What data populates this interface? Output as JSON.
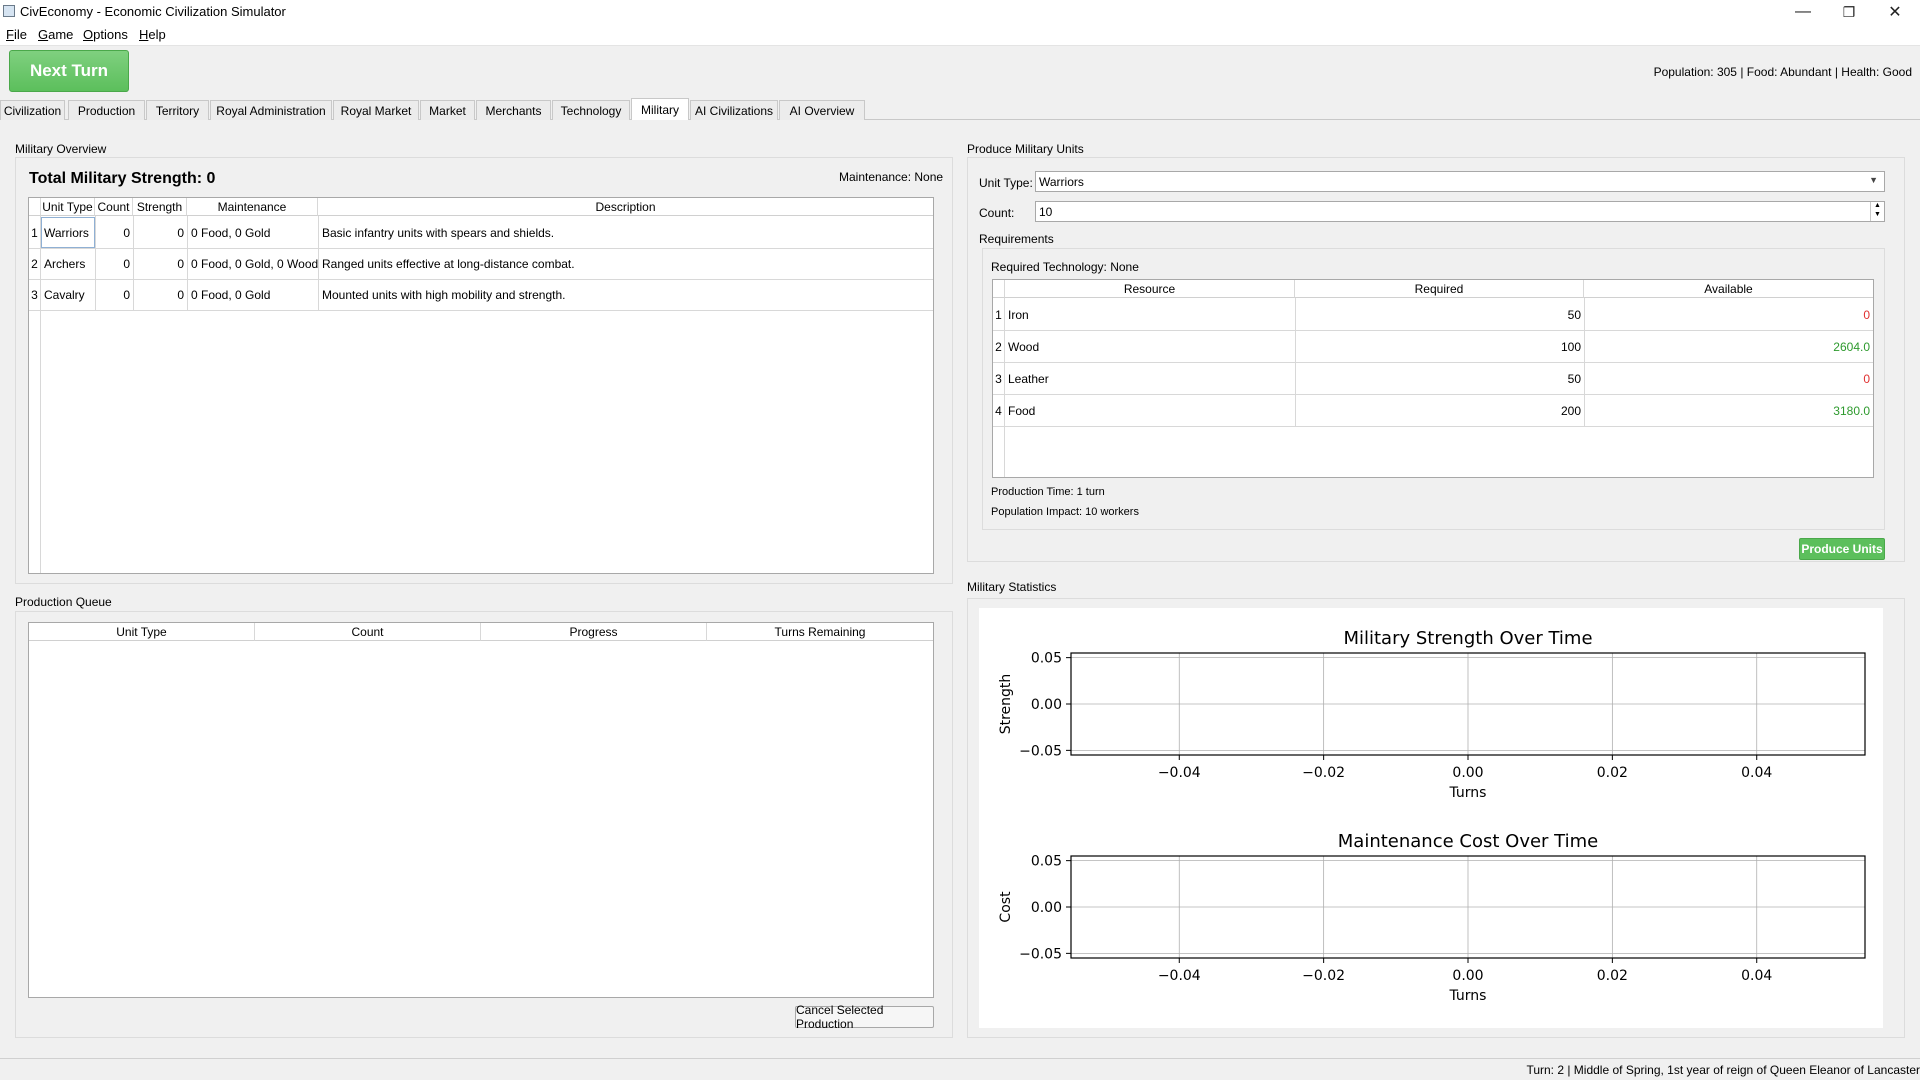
{
  "window": {
    "title": "CivEconomy - Economic Civilization Simulator",
    "minimize": "—",
    "restore": "❐",
    "close": "✕"
  },
  "menu": [
    {
      "u": "F",
      "rest": "ile"
    },
    {
      "u": "G",
      "rest": "ame"
    },
    {
      "u": "O",
      "rest": "ptions"
    },
    {
      "u": "H",
      "rest": "elp"
    }
  ],
  "toolbar": {
    "next_turn": "Next Turn",
    "status": "Population: 305 | Food: Abundant | Health: Good"
  },
  "tabs": [
    "Civilization",
    "Production",
    "Territory",
    "Royal Administration",
    "Royal Market",
    "Market",
    "Merchants",
    "Technology",
    "Military",
    "AI Civilizations",
    "AI Overview"
  ],
  "active_tab": "Military",
  "overview": {
    "group_title": "Military Overview",
    "total_label": "Total Military Strength: 0",
    "maintenance_label": "Maintenance: None",
    "headers": [
      "Unit Type",
      "Count",
      "Strength",
      "Maintenance",
      "Description"
    ],
    "rows": [
      {
        "n": "1",
        "type": "Warriors",
        "count": "0",
        "strength": "0",
        "maint": "0 Food, 0 Gold",
        "desc": "Basic infantry units with spears and shields."
      },
      {
        "n": "2",
        "type": "Archers",
        "count": "0",
        "strength": "0",
        "maint": "0 Food, 0 Gold, 0 Wood",
        "desc": "Ranged units effective at long-distance combat."
      },
      {
        "n": "3",
        "type": "Cavalry",
        "count": "0",
        "strength": "0",
        "maint": "0 Food, 0 Gold",
        "desc": "Mounted units with high mobility and strength."
      }
    ]
  },
  "queue": {
    "group_title": "Production Queue",
    "headers": [
      "Unit Type",
      "Count",
      "Progress",
      "Turns Remaining"
    ],
    "cancel": "Cancel Selected Production"
  },
  "produce": {
    "group_title": "Produce Military Units",
    "unit_type_label": "Unit Type:",
    "unit_type_value": "Warriors",
    "count_label": "Count:",
    "count_value": "10",
    "requirements_title": "Requirements",
    "required_tech": "Required Technology: None",
    "headers": [
      "Resource",
      "Required",
      "Available"
    ],
    "rows": [
      {
        "n": "1",
        "res": "Iron",
        "req": "50",
        "avail": "0",
        "ok": false
      },
      {
        "n": "2",
        "res": "Wood",
        "req": "100",
        "avail": "2604.0",
        "ok": true
      },
      {
        "n": "3",
        "res": "Leather",
        "req": "50",
        "avail": "0",
        "ok": false
      },
      {
        "n": "4",
        "res": "Food",
        "req": "200",
        "avail": "3180.0",
        "ok": true
      }
    ],
    "production_time": "Production Time: 1 turn",
    "population_impact": "Population Impact: 10 workers",
    "produce_button": "Produce Units",
    "colors": {
      "ok": "#2e9a2e",
      "bad": "#e03030"
    }
  },
  "stats": {
    "group_title": "Military Statistics",
    "charts": [
      {
        "title": "Military Strength Over Time",
        "xlabel": "Turns",
        "ylabel": "Strength",
        "xticks": [
          "−0.04",
          "−0.02",
          "0.00",
          "0.02",
          "0.04"
        ],
        "yticks": [
          "0.05",
          "0.00",
          "−0.05"
        ],
        "xlim": [
          -0.055,
          0.055
        ],
        "ylim": [
          -0.055,
          0.055
        ],
        "grid": true,
        "series": []
      },
      {
        "title": "Maintenance Cost Over Time",
        "xlabel": "Turns",
        "ylabel": "Cost",
        "xticks": [
          "−0.04",
          "−0.02",
          "0.00",
          "0.02",
          "0.04"
        ],
        "yticks": [
          "0.05",
          "0.00",
          "−0.05"
        ],
        "xlim": [
          -0.055,
          0.055
        ],
        "ylim": [
          -0.055,
          0.055
        ],
        "grid": true,
        "series": []
      }
    ]
  },
  "chart_data": [
    {
      "type": "line",
      "title": "Military Strength Over Time",
      "xlabel": "Turns",
      "ylabel": "Strength",
      "x": [],
      "series": [],
      "xlim": [
        -0.055,
        0.055
      ],
      "ylim": [
        -0.055,
        0.055
      ],
      "grid": true
    },
    {
      "type": "line",
      "title": "Maintenance Cost Over Time",
      "xlabel": "Turns",
      "ylabel": "Cost",
      "x": [],
      "series": [],
      "xlim": [
        -0.055,
        0.055
      ],
      "ylim": [
        -0.055,
        0.055
      ],
      "grid": true
    }
  ],
  "statusbar": "Turn: 2 | Middle of Spring, 1st year of reign of Queen Eleanor of Lancaster"
}
